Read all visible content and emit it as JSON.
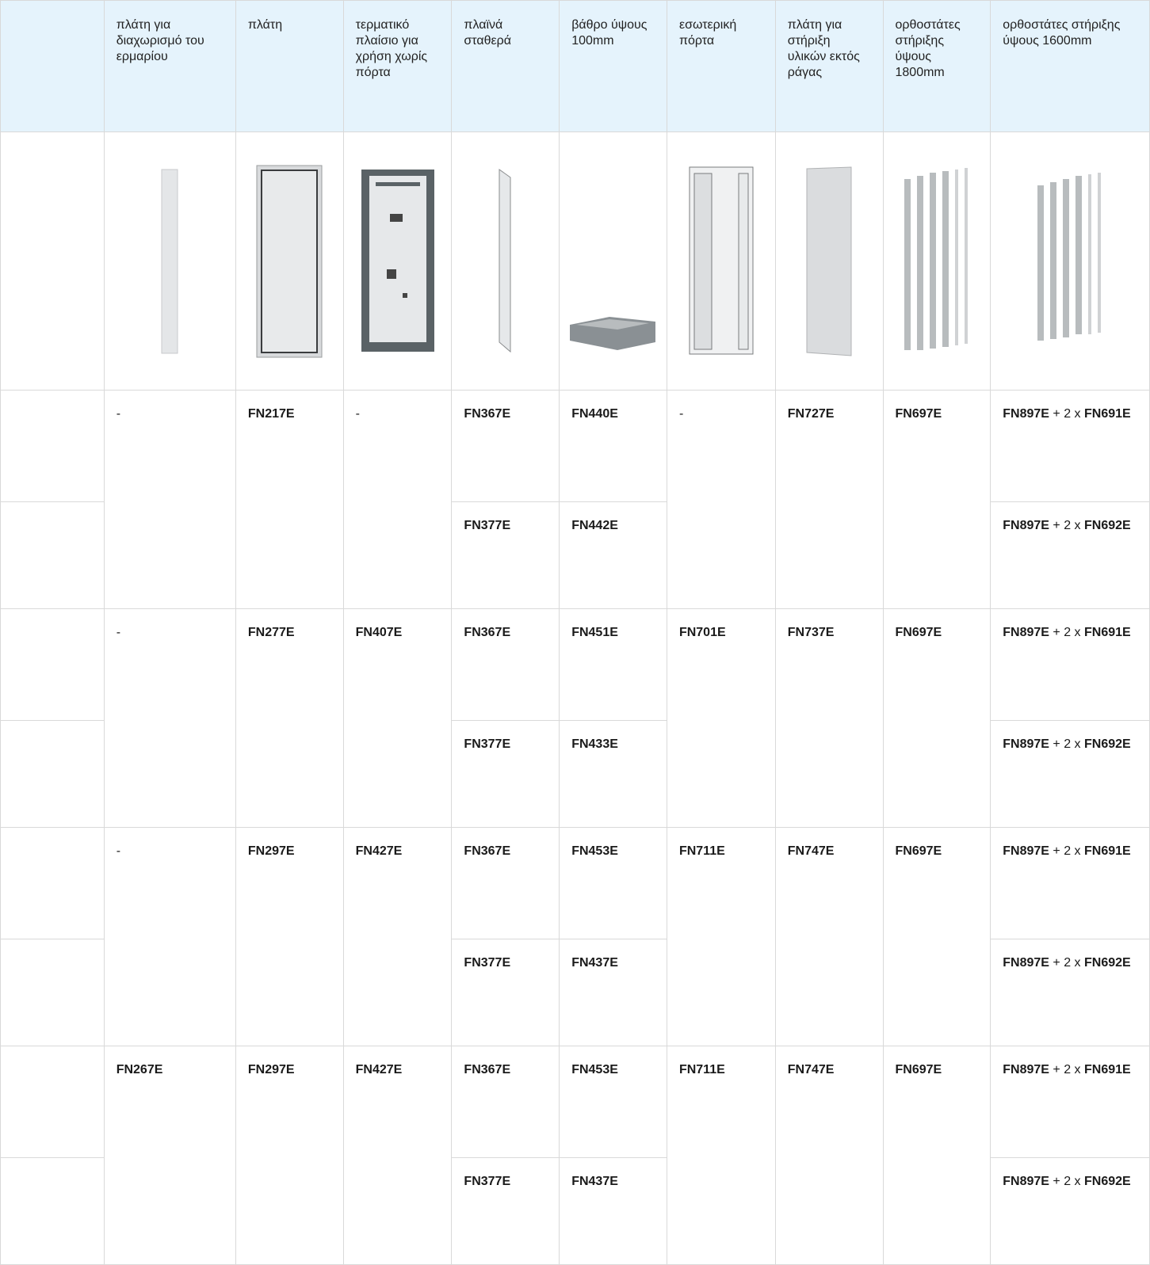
{
  "headers": [
    "",
    "πλάτη για διαχωρισμό του ερμαρίου",
    "πλάτη",
    "τερματικό πλαίσιο για χρήση χωρίς πόρτα",
    "πλαϊνά σταθερά",
    "βάθρο ύψους 100mm",
    "εσωτερική πόρτα",
    "πλάτη για στήριξη υλικών εκτός ράγας",
    "ορθοστάτες στήριξης ύψους 1800mm",
    "ορθοστάτες στήριξης ύψους 1600mm"
  ],
  "groups": [
    {
      "partition": "-",
      "back": "FN217E",
      "terminal": "-",
      "door": "-",
      "mount": "FN727E",
      "upr1800": "FN697E",
      "rows": [
        {
          "side": "FN367E",
          "base": "FN440E",
          "u1600_a": "FN897E",
          "u1600_mid": " + 2 x ",
          "u1600_b": "FN691E"
        },
        {
          "side": "FN377E",
          "base": "FN442E",
          "u1600_a": "FN897E",
          "u1600_mid": " + 2 x ",
          "u1600_b": "FN692E"
        }
      ]
    },
    {
      "partition": "-",
      "back": "FN277E",
      "terminal": "FN407E",
      "door": "FN701E",
      "mount": "FN737E",
      "upr1800": "FN697E",
      "rows": [
        {
          "side": "FN367E",
          "base": "FN451E",
          "u1600_a": "FN897E",
          "u1600_mid": " + 2 x ",
          "u1600_b": "FN691E"
        },
        {
          "side": "FN377E",
          "base": "FN433E",
          "u1600_a": "FN897E",
          "u1600_mid": " + 2 x ",
          "u1600_b": "FN692E"
        }
      ]
    },
    {
      "partition": "-",
      "back": "FN297E",
      "terminal": "FN427E",
      "door": "FN711E",
      "mount": "FN747E",
      "upr1800": "FN697E",
      "rows": [
        {
          "side": "FN367E",
          "base": "FN453E",
          "u1600_a": "FN897E",
          "u1600_mid": " + 2 x ",
          "u1600_b": "FN691E"
        },
        {
          "side": "FN377E",
          "base": "FN437E",
          "u1600_a": "FN897E",
          "u1600_mid": " + 2 x ",
          "u1600_b": "FN692E"
        }
      ]
    },
    {
      "partition": "FN267E",
      "back": "FN297E",
      "terminal": "FN427E",
      "door": "FN711E",
      "mount": "FN747E",
      "upr1800": "FN697E",
      "rows": [
        {
          "side": "FN367E",
          "base": "FN453E",
          "u1600_a": "FN897E",
          "u1600_mid": " + 2 x ",
          "u1600_b": "FN691E"
        },
        {
          "side": "FN377E",
          "base": "FN437E",
          "u1600_a": "FN897E",
          "u1600_mid": " + 2 x ",
          "u1600_b": "FN692E"
        }
      ]
    }
  ],
  "images": [
    "partition-panel-image",
    "back-panel-image",
    "terminal-frame-image",
    "side-panel-image",
    "plinth-image",
    "internal-door-image",
    "mounting-plate-image",
    "uprights-1800-image",
    "uprights-1600-image"
  ],
  "colors": {
    "header_bg": "#e5f3fc",
    "grid": "#d9d9d9"
  }
}
